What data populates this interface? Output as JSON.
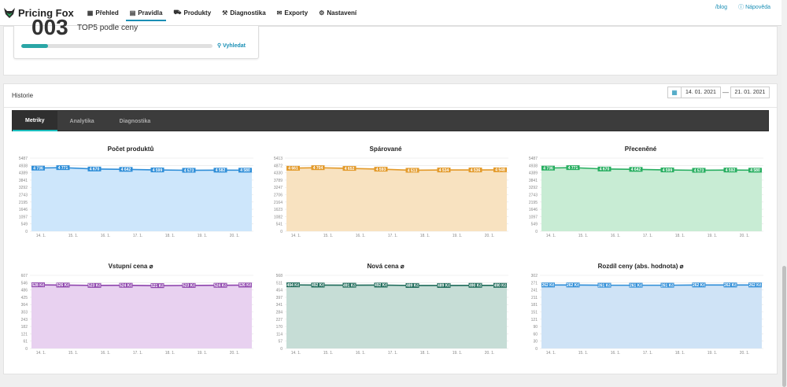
{
  "header": {
    "logo_text": "Pricing Fox",
    "nav": [
      {
        "label": "Přehled",
        "icon": "dashboard-icon"
      },
      {
        "label": "Pravidla",
        "icon": "rules-icon"
      },
      {
        "label": "Produkty",
        "icon": "products-icon"
      },
      {
        "label": "Diagnostika",
        "icon": "diagnostics-icon"
      },
      {
        "label": "Exporty",
        "icon": "export-icon"
      },
      {
        "label": "Nastavení",
        "icon": "settings-icon"
      }
    ],
    "active_nav": "Pravidla",
    "blog_link": "/blog",
    "help_link": "Nápověda"
  },
  "top_card": {
    "big_number": "003",
    "label": "TOP5 podle ceny",
    "progress": 0.14,
    "search_link": "Vyhledat"
  },
  "history": {
    "title": "Historie",
    "date_from": "14. 01. 2021",
    "date_separator": "—",
    "date_to": "21. 01. 2021",
    "tabs": [
      "Metriky",
      "Analytika",
      "Diagnostika"
    ],
    "active_tab": "Metriky"
  },
  "colors": {
    "accent": "#1a8fb5",
    "teal": "#2aa6a6"
  },
  "chart_data": [
    {
      "type": "area",
      "title": "Počet produktů",
      "color": "#2f8ed8",
      "fill": "#cde6fb",
      "x": [
        "14. 1.",
        "15. 1.",
        "16. 1.",
        "17. 1.",
        "18. 1.",
        "19. 1.",
        "20. 1."
      ],
      "yticks": [
        "5487",
        "4938",
        "4389",
        "3841",
        "3292",
        "2743",
        "2195",
        "1646",
        "1097",
        "549",
        "0"
      ],
      "ylim": [
        0,
        5487
      ],
      "values": [
        4736,
        4771,
        4670,
        4642,
        4599,
        4573,
        4582,
        4580
      ],
      "labels": [
        "4 736",
        "4 771",
        "4 670",
        "4 642",
        "4 599",
        "4 573",
        "4 582",
        "4 580"
      ]
    },
    {
      "type": "area",
      "title": "Spárované",
      "color": "#e39a2a",
      "fill": "#f8e2c0",
      "x": [
        "14. 1.",
        "15. 1.",
        "16. 1.",
        "17. 1.",
        "18. 1.",
        "19. 1.",
        "20. 1."
      ],
      "yticks": [
        "5413",
        "4872",
        "4330",
        "3789",
        "3247",
        "2706",
        "2164",
        "1623",
        "1082",
        "541",
        "0"
      ],
      "ylim": [
        0,
        5413
      ],
      "values": [
        4661,
        4704,
        4652,
        4593,
        4513,
        4534,
        4536,
        4548
      ],
      "labels": [
        "4 661",
        "4 704",
        "4 652",
        "4 593",
        "4 513",
        "4 534",
        "4 536",
        "4 548"
      ]
    },
    {
      "type": "area",
      "title": "Přeceněné",
      "color": "#27ae60",
      "fill": "#c8ecd4",
      "x": [
        "14. 1.",
        "15. 1.",
        "16. 1.",
        "17. 1.",
        "18. 1.",
        "19. 1.",
        "20. 1."
      ],
      "yticks": [
        "5487",
        "4938",
        "4389",
        "3841",
        "3292",
        "2743",
        "2195",
        "1646",
        "1097",
        "549",
        "0"
      ],
      "ylim": [
        0,
        5487
      ],
      "values": [
        4736,
        4771,
        4670,
        4642,
        4599,
        4573,
        4592,
        4580
      ],
      "labels": [
        "4 736",
        "4 771",
        "4 670",
        "4 642",
        "4 599",
        "4 573",
        "4 592",
        "4 580"
      ]
    },
    {
      "type": "area",
      "title": "Vstupní cena ⌀",
      "color": "#8e44ad",
      "fill": "#e8d1f0",
      "x": [
        "14. 1.",
        "15. 1.",
        "16. 1.",
        "17. 1.",
        "18. 1.",
        "19. 1.",
        "20. 1."
      ],
      "yticks": [
        "607",
        "546",
        "486",
        "425",
        "364",
        "303",
        "243",
        "182",
        "121",
        "61",
        "0"
      ],
      "ylim": [
        0,
        607
      ],
      "values": [
        528,
        526,
        523,
        524,
        521,
        523,
        524,
        526
      ],
      "labels": [
        "528 Kč",
        "526 Kč",
        "523 Kč",
        "524 Kč",
        "521 Kč",
        "523 Kč",
        "524 Kč",
        "526 Kč"
      ]
    },
    {
      "type": "area",
      "title": "Nová cena ⌀",
      "color": "#1e6b5a",
      "fill": "#c6ddd6",
      "x": [
        "14. 1.",
        "15. 1.",
        "16. 1.",
        "17. 1.",
        "18. 1.",
        "19. 1.",
        "20. 1."
      ],
      "yticks": [
        "568",
        "511",
        "454",
        "397",
        "341",
        "284",
        "227",
        "170",
        "114",
        "57",
        "0"
      ],
      "ylim": [
        0,
        568
      ],
      "values": [
        494,
        492,
        491,
        492,
        489,
        489,
        490,
        490
      ],
      "labels": [
        "494 Kč",
        "492 Kč",
        "491 Kč",
        "492 Kč",
        "489 Kč",
        "489 Kč",
        "490 Kč",
        "490 Kč"
      ]
    },
    {
      "type": "area",
      "title": "Rozdíl ceny (abs. hodnota) ⌀",
      "color": "#2f8ed8",
      "fill": "#cfe3f6",
      "x": [
        "14. 1.",
        "15. 1.",
        "16. 1.",
        "17. 1.",
        "18. 1.",
        "19. 1.",
        "20. 1."
      ],
      "yticks": [
        "302",
        "271",
        "241",
        "211",
        "181",
        "151",
        "121",
        "90",
        "60",
        "30",
        "0"
      ],
      "ylim": [
        0,
        302
      ],
      "values": [
        262,
        262,
        261,
        261,
        261,
        262,
        262,
        262
      ],
      "labels": [
        "262 Kč",
        "262 Kč",
        "261 Kč",
        "261 Kč",
        "261 Kč",
        "262 Kč",
        "262 Kč",
        "262 Kč"
      ]
    }
  ]
}
